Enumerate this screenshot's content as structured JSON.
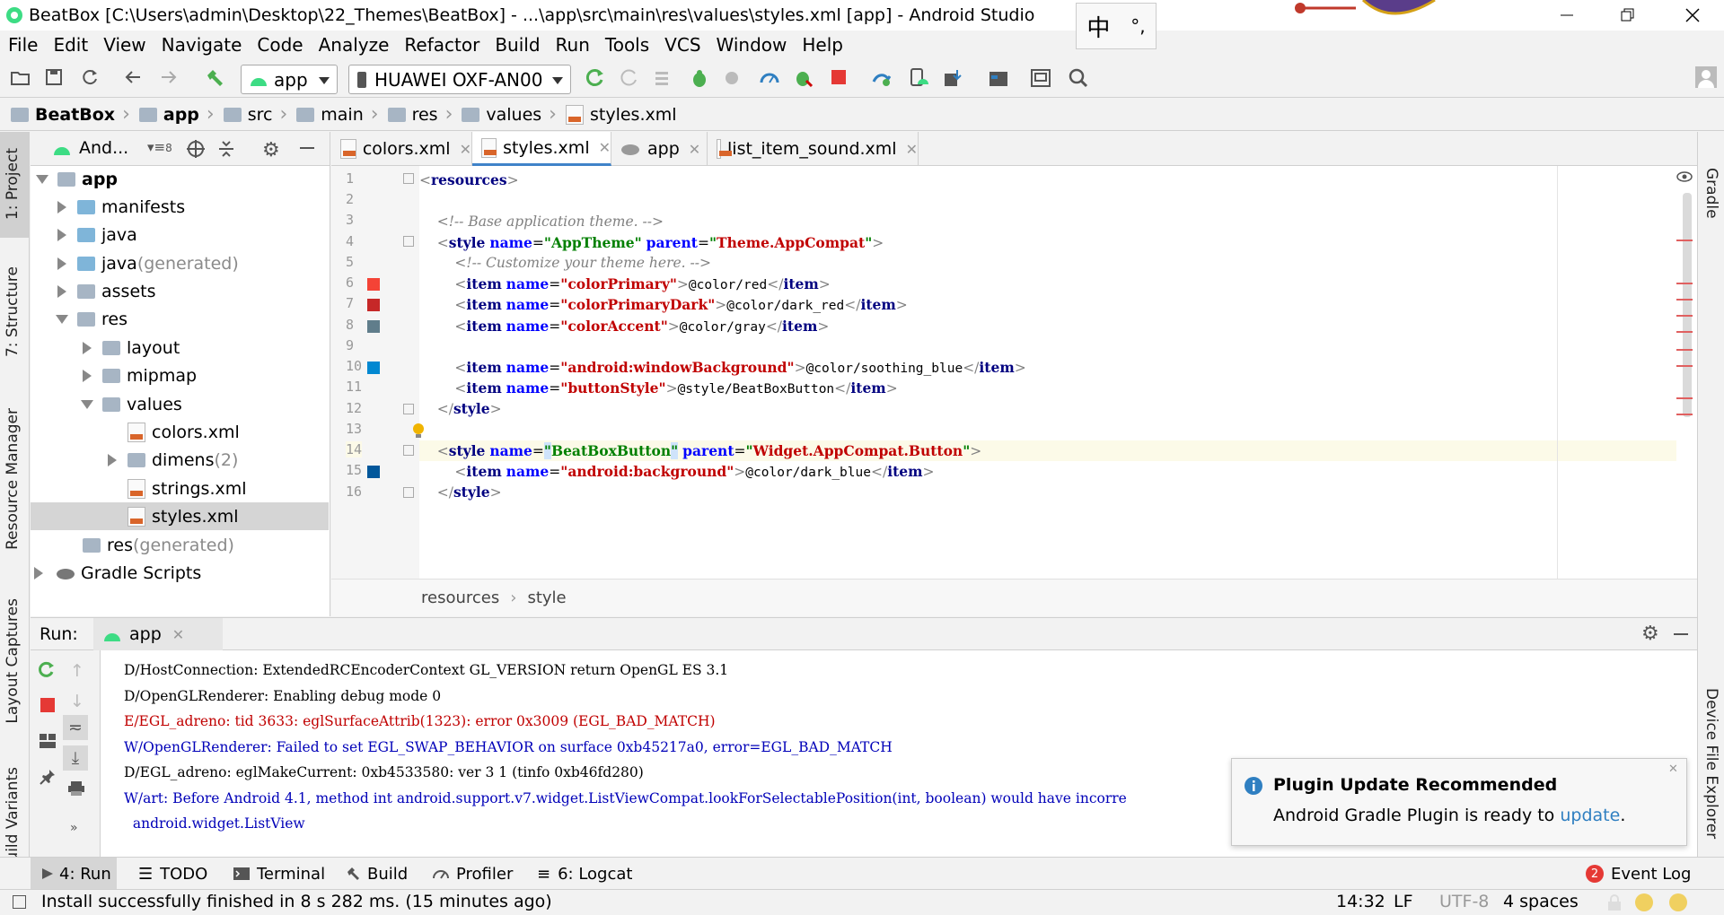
{
  "window": {
    "title": "BeatBox [C:\\Users\\admin\\Desktop\\22_Themes\\BeatBox] - ...\\app\\src\\main\\res\\values\\styles.xml [app] - Android Studio"
  },
  "ime": {
    "lang": "中",
    "punct": "°,"
  },
  "menu": [
    "File",
    "Edit",
    "View",
    "Navigate",
    "Code",
    "Analyze",
    "Refactor",
    "Build",
    "Run",
    "Tools",
    "VCS",
    "Window",
    "Help"
  ],
  "toolbar": {
    "config": "app",
    "device": "HUAWEI OXF-AN00"
  },
  "breadcrumb": [
    "BeatBox",
    "app",
    "src",
    "main",
    "res",
    "values",
    "styles.xml"
  ],
  "left_tabs": [
    "1: Project",
    "7: Structure",
    "Resource Manager",
    "Layout Captures",
    "Build Variants"
  ],
  "right_tabs": [
    "Gradle",
    "Device File Explorer"
  ],
  "project": {
    "view": "And...",
    "badge": "8",
    "tree": [
      {
        "label": "app",
        "suffix": ""
      },
      {
        "label": "manifests",
        "suffix": ""
      },
      {
        "label": "java",
        "suffix": ""
      },
      {
        "label": "java",
        "suffix": " (generated)"
      },
      {
        "label": "assets",
        "suffix": ""
      },
      {
        "label": "res",
        "suffix": ""
      },
      {
        "label": "layout",
        "suffix": ""
      },
      {
        "label": "mipmap",
        "suffix": ""
      },
      {
        "label": "values",
        "suffix": ""
      },
      {
        "label": "colors.xml",
        "suffix": ""
      },
      {
        "label": "dimens",
        "suffix": " (2)"
      },
      {
        "label": "strings.xml",
        "suffix": ""
      },
      {
        "label": "styles.xml",
        "suffix": ""
      },
      {
        "label": "res",
        "suffix": " (generated)"
      },
      {
        "label": "Gradle Scripts",
        "suffix": ""
      }
    ]
  },
  "editor_tabs": [
    "colors.xml",
    "styles.xml",
    "app",
    "list_item_sound.xml"
  ],
  "code": {
    "line_numbers": [
      "1",
      "2",
      "3",
      "4",
      "5",
      "6",
      "7",
      "8",
      "9",
      "10",
      "11",
      "12",
      "13",
      "14",
      "15",
      "16"
    ],
    "l1": "resources",
    "l3": "<!-- Base application theme. -->",
    "l4": {
      "tag": "style",
      "a1": "name",
      "v1": "AppTheme",
      "a2": "parent",
      "v2": "Theme.AppCompat"
    },
    "l5": "<!-- Customize your theme here. -->",
    "l6": {
      "tag": "item",
      "a": "name",
      "v": "colorPrimary",
      "text": "@color/red"
    },
    "l7": {
      "tag": "item",
      "a": "name",
      "v": "colorPrimaryDark",
      "text": "@color/dark_red"
    },
    "l8": {
      "tag": "item",
      "a": "name",
      "v": "colorAccent",
      "text": "@color/gray"
    },
    "l10": {
      "tag": "item",
      "a": "name",
      "v": "android:windowBackground",
      "text": "@color/soothing_blue"
    },
    "l11": {
      "tag": "item",
      "a": "name",
      "v": "buttonStyle",
      "text": "@style/BeatBoxButton"
    },
    "l12": "style",
    "l14": {
      "tag": "style",
      "a1": "name",
      "v1": "BeatBoxButton",
      "a2": "parent",
      "v2": "Widget.AppCompat.Button"
    },
    "l15": {
      "tag": "item",
      "a": "name",
      "v": "android:background",
      "text": "@color/dark_blue"
    },
    "l16": "style"
  },
  "swatch_colors": {
    "l6": "#f44336",
    "l7": "#c62828",
    "l8": "#607d8b",
    "l10": "#0288d1",
    "l15": "#01579b"
  },
  "editor_breadcrumb": [
    "resources",
    "style"
  ],
  "run": {
    "label": "Run:",
    "tab": "app",
    "console": [
      {
        "t": "D/HostConnection: ExtendedRCEncoderContext GL_VERSION return OpenGL ES 3.1",
        "k": "d"
      },
      {
        "t": "D/OpenGLRenderer: Enabling debug mode 0",
        "k": "d"
      },
      {
        "t": "E/EGL_adreno: tid 3633: eglSurfaceAttrib(1323): error 0x3009 (EGL_BAD_MATCH)",
        "k": "e"
      },
      {
        "t": "W/OpenGLRenderer: Failed to set EGL_SWAP_BEHAVIOR on surface 0xb45217a0, error=EGL_BAD_MATCH",
        "k": "w"
      },
      {
        "t": "D/EGL_adreno: eglMakeCurrent: 0xb4533580: ver 3 1 (tinfo 0xb46fd280)",
        "k": "d"
      },
      {
        "t": "W/art: Before Android 4.1, method int android.support.v7.widget.ListViewCompat.lookForSelectablePosition(int, boolean) would have incorre",
        "k": "w"
      },
      {
        "t": "  android.widget.ListView",
        "k": "w"
      }
    ]
  },
  "notification": {
    "title": "Plugin Update Recommended",
    "body": "Android Gradle Plugin is ready to ",
    "link": "update",
    "end": "."
  },
  "bottom_tabs": [
    "4: Run",
    "TODO",
    "Terminal",
    "Build",
    "Profiler",
    "6: Logcat"
  ],
  "event_log": {
    "count": "2",
    "label": "Event Log"
  },
  "status": {
    "message": "Install successfully finished in 8 s 282 ms. (15 minutes ago)",
    "position": "14:32",
    "line_sep": "LF",
    "encoding": "UTF-8",
    "indent": "4 spaces"
  }
}
